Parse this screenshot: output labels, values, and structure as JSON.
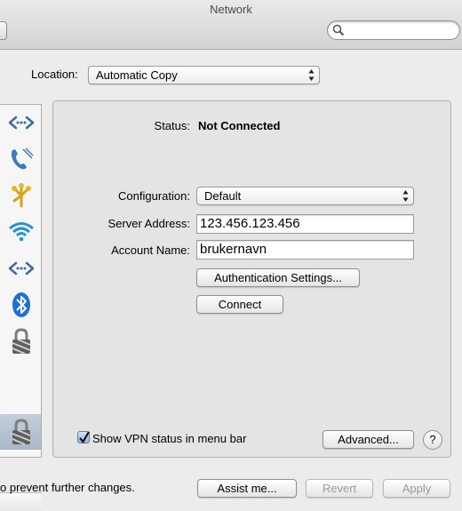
{
  "window": {
    "title": "Network"
  },
  "search": {
    "placeholder": ""
  },
  "location": {
    "label": "Location:",
    "value": "Automatic Copy"
  },
  "sidebar": {
    "items": [
      {
        "icon": "ethernet-icon"
      },
      {
        "icon": "phone-modem-icon"
      },
      {
        "icon": "firewire-icon"
      },
      {
        "icon": "wifi-icon"
      },
      {
        "icon": "ethernet-icon"
      },
      {
        "icon": "bluetooth-icon"
      },
      {
        "icon": "vpn-lock-icon"
      },
      {
        "icon": "vpn-lock-icon",
        "selected": true
      }
    ]
  },
  "detail": {
    "status_label": "Status:",
    "status_value": "Not Connected",
    "configuration_label": "Configuration:",
    "configuration_value": "Default",
    "server_label": "Server Address:",
    "server_value": "123.456.123.456",
    "account_label": "Account Name:",
    "account_value": "brukernavn",
    "auth_button": "Authentication Settings...",
    "connect_button": "Connect",
    "show_vpn_label": "Show VPN status in menu bar",
    "show_vpn_checked": true,
    "advanced_button": "Advanced...",
    "help_button": "?"
  },
  "footer": {
    "lock_text": "o prevent further changes.",
    "assist_button": "Assist me...",
    "revert_button": "Revert",
    "apply_button": "Apply"
  },
  "colors": {
    "selected_row": "#b5c3d3",
    "accent": "#2b7fe0"
  }
}
